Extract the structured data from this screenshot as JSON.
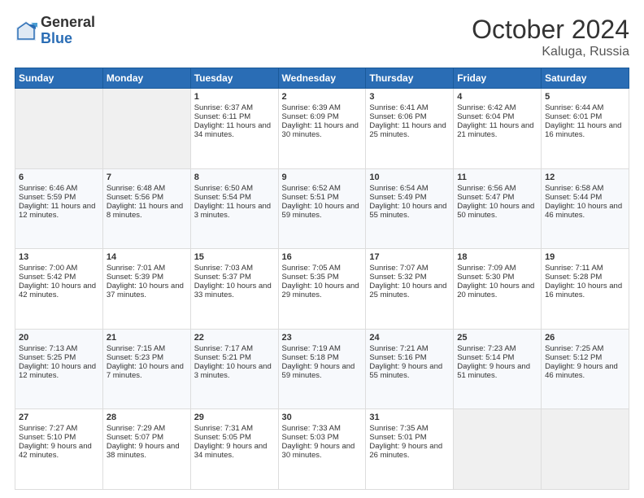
{
  "header": {
    "logo_general": "General",
    "logo_blue": "Blue",
    "month_title": "October 2024",
    "location": "Kaluga, Russia"
  },
  "days_of_week": [
    "Sunday",
    "Monday",
    "Tuesday",
    "Wednesday",
    "Thursday",
    "Friday",
    "Saturday"
  ],
  "weeks": [
    [
      {
        "day": "",
        "sunrise": "",
        "sunset": "",
        "daylight": "",
        "empty": true
      },
      {
        "day": "",
        "sunrise": "",
        "sunset": "",
        "daylight": "",
        "empty": true
      },
      {
        "day": "1",
        "sunrise": "Sunrise: 6:37 AM",
        "sunset": "Sunset: 6:11 PM",
        "daylight": "Daylight: 11 hours and 34 minutes."
      },
      {
        "day": "2",
        "sunrise": "Sunrise: 6:39 AM",
        "sunset": "Sunset: 6:09 PM",
        "daylight": "Daylight: 11 hours and 30 minutes."
      },
      {
        "day": "3",
        "sunrise": "Sunrise: 6:41 AM",
        "sunset": "Sunset: 6:06 PM",
        "daylight": "Daylight: 11 hours and 25 minutes."
      },
      {
        "day": "4",
        "sunrise": "Sunrise: 6:42 AM",
        "sunset": "Sunset: 6:04 PM",
        "daylight": "Daylight: 11 hours and 21 minutes."
      },
      {
        "day": "5",
        "sunrise": "Sunrise: 6:44 AM",
        "sunset": "Sunset: 6:01 PM",
        "daylight": "Daylight: 11 hours and 16 minutes."
      }
    ],
    [
      {
        "day": "6",
        "sunrise": "Sunrise: 6:46 AM",
        "sunset": "Sunset: 5:59 PM",
        "daylight": "Daylight: 11 hours and 12 minutes."
      },
      {
        "day": "7",
        "sunrise": "Sunrise: 6:48 AM",
        "sunset": "Sunset: 5:56 PM",
        "daylight": "Daylight: 11 hours and 8 minutes."
      },
      {
        "day": "8",
        "sunrise": "Sunrise: 6:50 AM",
        "sunset": "Sunset: 5:54 PM",
        "daylight": "Daylight: 11 hours and 3 minutes."
      },
      {
        "day": "9",
        "sunrise": "Sunrise: 6:52 AM",
        "sunset": "Sunset: 5:51 PM",
        "daylight": "Daylight: 10 hours and 59 minutes."
      },
      {
        "day": "10",
        "sunrise": "Sunrise: 6:54 AM",
        "sunset": "Sunset: 5:49 PM",
        "daylight": "Daylight: 10 hours and 55 minutes."
      },
      {
        "day": "11",
        "sunrise": "Sunrise: 6:56 AM",
        "sunset": "Sunset: 5:47 PM",
        "daylight": "Daylight: 10 hours and 50 minutes."
      },
      {
        "day": "12",
        "sunrise": "Sunrise: 6:58 AM",
        "sunset": "Sunset: 5:44 PM",
        "daylight": "Daylight: 10 hours and 46 minutes."
      }
    ],
    [
      {
        "day": "13",
        "sunrise": "Sunrise: 7:00 AM",
        "sunset": "Sunset: 5:42 PM",
        "daylight": "Daylight: 10 hours and 42 minutes."
      },
      {
        "day": "14",
        "sunrise": "Sunrise: 7:01 AM",
        "sunset": "Sunset: 5:39 PM",
        "daylight": "Daylight: 10 hours and 37 minutes."
      },
      {
        "day": "15",
        "sunrise": "Sunrise: 7:03 AM",
        "sunset": "Sunset: 5:37 PM",
        "daylight": "Daylight: 10 hours and 33 minutes."
      },
      {
        "day": "16",
        "sunrise": "Sunrise: 7:05 AM",
        "sunset": "Sunset: 5:35 PM",
        "daylight": "Daylight: 10 hours and 29 minutes."
      },
      {
        "day": "17",
        "sunrise": "Sunrise: 7:07 AM",
        "sunset": "Sunset: 5:32 PM",
        "daylight": "Daylight: 10 hours and 25 minutes."
      },
      {
        "day": "18",
        "sunrise": "Sunrise: 7:09 AM",
        "sunset": "Sunset: 5:30 PM",
        "daylight": "Daylight: 10 hours and 20 minutes."
      },
      {
        "day": "19",
        "sunrise": "Sunrise: 7:11 AM",
        "sunset": "Sunset: 5:28 PM",
        "daylight": "Daylight: 10 hours and 16 minutes."
      }
    ],
    [
      {
        "day": "20",
        "sunrise": "Sunrise: 7:13 AM",
        "sunset": "Sunset: 5:25 PM",
        "daylight": "Daylight: 10 hours and 12 minutes."
      },
      {
        "day": "21",
        "sunrise": "Sunrise: 7:15 AM",
        "sunset": "Sunset: 5:23 PM",
        "daylight": "Daylight: 10 hours and 7 minutes."
      },
      {
        "day": "22",
        "sunrise": "Sunrise: 7:17 AM",
        "sunset": "Sunset: 5:21 PM",
        "daylight": "Daylight: 10 hours and 3 minutes."
      },
      {
        "day": "23",
        "sunrise": "Sunrise: 7:19 AM",
        "sunset": "Sunset: 5:18 PM",
        "daylight": "Daylight: 9 hours and 59 minutes."
      },
      {
        "day": "24",
        "sunrise": "Sunrise: 7:21 AM",
        "sunset": "Sunset: 5:16 PM",
        "daylight": "Daylight: 9 hours and 55 minutes."
      },
      {
        "day": "25",
        "sunrise": "Sunrise: 7:23 AM",
        "sunset": "Sunset: 5:14 PM",
        "daylight": "Daylight: 9 hours and 51 minutes."
      },
      {
        "day": "26",
        "sunrise": "Sunrise: 7:25 AM",
        "sunset": "Sunset: 5:12 PM",
        "daylight": "Daylight: 9 hours and 46 minutes."
      }
    ],
    [
      {
        "day": "27",
        "sunrise": "Sunrise: 7:27 AM",
        "sunset": "Sunset: 5:10 PM",
        "daylight": "Daylight: 9 hours and 42 minutes."
      },
      {
        "day": "28",
        "sunrise": "Sunrise: 7:29 AM",
        "sunset": "Sunset: 5:07 PM",
        "daylight": "Daylight: 9 hours and 38 minutes."
      },
      {
        "day": "29",
        "sunrise": "Sunrise: 7:31 AM",
        "sunset": "Sunset: 5:05 PM",
        "daylight": "Daylight: 9 hours and 34 minutes."
      },
      {
        "day": "30",
        "sunrise": "Sunrise: 7:33 AM",
        "sunset": "Sunset: 5:03 PM",
        "daylight": "Daylight: 9 hours and 30 minutes."
      },
      {
        "day": "31",
        "sunrise": "Sunrise: 7:35 AM",
        "sunset": "Sunset: 5:01 PM",
        "daylight": "Daylight: 9 hours and 26 minutes."
      },
      {
        "day": "",
        "sunrise": "",
        "sunset": "",
        "daylight": "",
        "empty": true
      },
      {
        "day": "",
        "sunrise": "",
        "sunset": "",
        "daylight": "",
        "empty": true
      }
    ]
  ]
}
